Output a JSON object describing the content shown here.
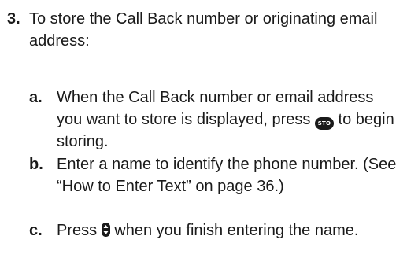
{
  "step": {
    "number": "3.",
    "text": "To store the Call Back number or originating email address:"
  },
  "substeps": {
    "a": {
      "letter": "a.",
      "text_before": "When the Call Back number or email address you want to store is displayed, press",
      "key_label": "STO",
      "text_after": "to begin storing."
    },
    "b": {
      "letter": "b.",
      "text": "Enter a name to identify the phone number. (See “How to Enter Text” on page 36.)"
    },
    "c": {
      "letter": "c.",
      "text_before": "Press",
      "text_after": "when you finish entering the name."
    }
  },
  "icons": {
    "sto_key": "sto-key-icon",
    "nav_key": "navigation-key-icon"
  },
  "colors": {
    "text": "#1a1a1a",
    "key_fill": "#1a1a1a",
    "key_text": "#ffffff"
  }
}
